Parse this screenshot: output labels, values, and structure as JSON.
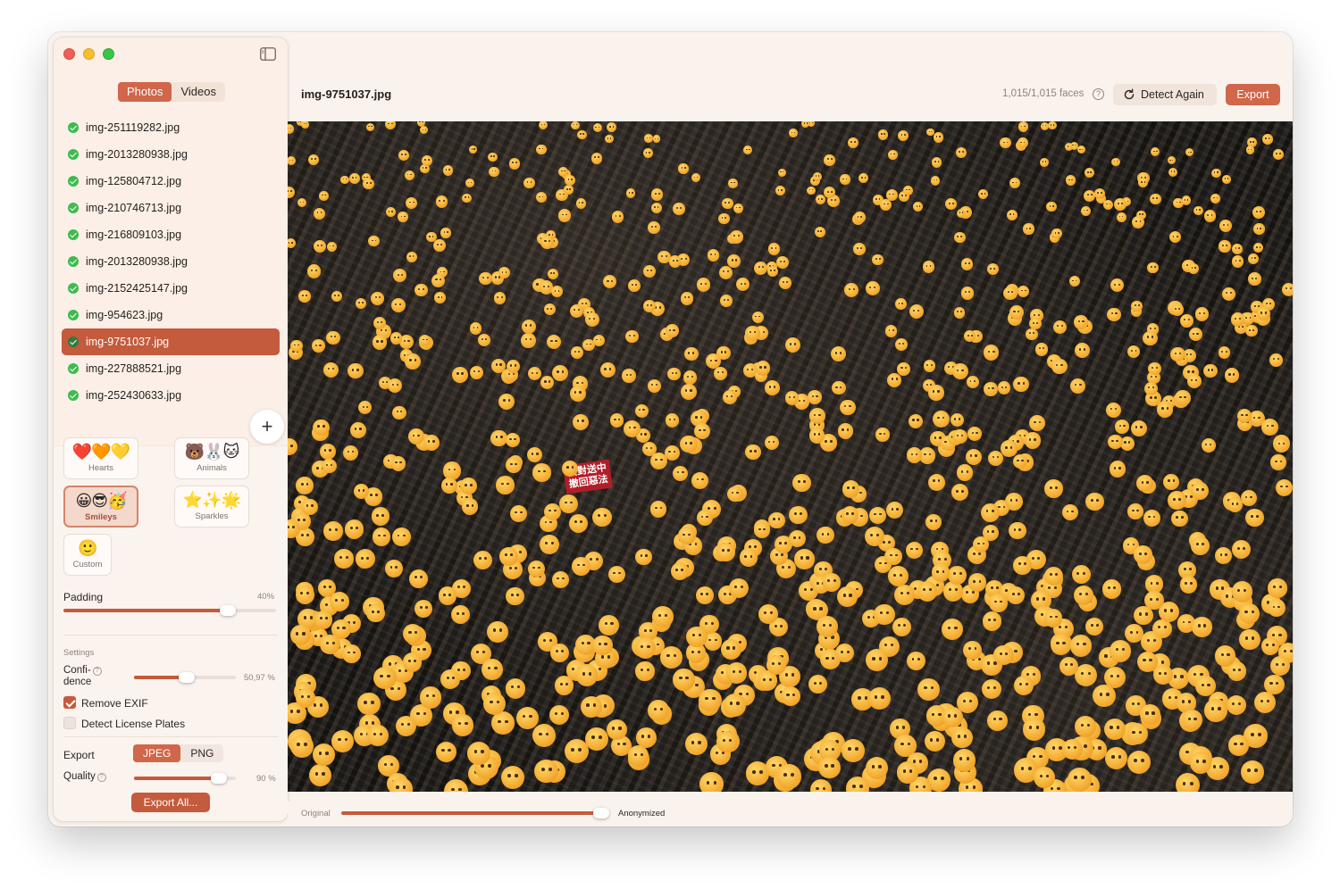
{
  "sidebar": {
    "media_tabs": [
      "Photos",
      "Videos"
    ],
    "active_media_tab": "Photos",
    "files": [
      {
        "name": "img-251119282.jpg",
        "selected": false
      },
      {
        "name": "img-2013280938.jpg",
        "selected": false
      },
      {
        "name": "img-125804712.jpg",
        "selected": false
      },
      {
        "name": "img-210746713.jpg",
        "selected": false
      },
      {
        "name": "img-216809103.jpg",
        "selected": false
      },
      {
        "name": "img-2013280938.jpg",
        "selected": false
      },
      {
        "name": "img-2152425147.jpg",
        "selected": false
      },
      {
        "name": "img-954623.jpg",
        "selected": false
      },
      {
        "name": "img-9751037.jpg",
        "selected": true
      },
      {
        "name": "img-227888521.jpg",
        "selected": false
      },
      {
        "name": "img-252430633.jpg",
        "selected": false
      }
    ],
    "add_label": "+",
    "styles": [
      {
        "name": "Hearts",
        "emojis": "❤️🧡💛",
        "active": false
      },
      {
        "name": "Animals",
        "emojis": "🐻🐰🐱",
        "active": false
      },
      {
        "name": "Smileys",
        "emojis": "😀😎🥳",
        "active": true
      },
      {
        "name": "Sparkles",
        "emojis": "⭐✨🌟",
        "active": false
      },
      {
        "name": "Custom",
        "emojis": "🙂",
        "active": false
      }
    ],
    "padding": {
      "label": "Padding",
      "value_text": "40%",
      "value": 0.4
    },
    "settings": {
      "heading": "Settings",
      "confidence_label_1": "Confi-",
      "confidence_label_2": "dence",
      "confidence_help": "?",
      "confidence_value_text": "50,97 %",
      "confidence_value": 0.5097,
      "remove_exif": {
        "label": "Remove EXIF",
        "checked": true
      },
      "detect_plates": {
        "label": "Detect License Plates",
        "checked": false
      }
    },
    "export": {
      "label": "Export",
      "formats": [
        "JPEG",
        "PNG"
      ],
      "active_format": "JPEG",
      "quality_label": "Quality",
      "quality_help": "?",
      "quality_value_text": "90 %",
      "quality_value": 0.9,
      "export_all_label": "Export All..."
    }
  },
  "main": {
    "file_title": "img-9751037.jpg",
    "faces_count": "1,015/1,015 faces",
    "faces_help": "?",
    "detect_again_label": "Detect Again",
    "export_label": "Export",
    "image_caption_signs": [
      "反對送中\n撤回惡法",
      "撤回惡法"
    ],
    "compare": {
      "left_label": "Original",
      "right_label": "Anonymized",
      "value": 1.0
    }
  },
  "colors": {
    "accent": "#c35b3c",
    "accent_light": "#d0664a",
    "sidebar_bg": "#fbefe7",
    "window_bg": "#faf2ec",
    "success": "#3dbb4f"
  }
}
